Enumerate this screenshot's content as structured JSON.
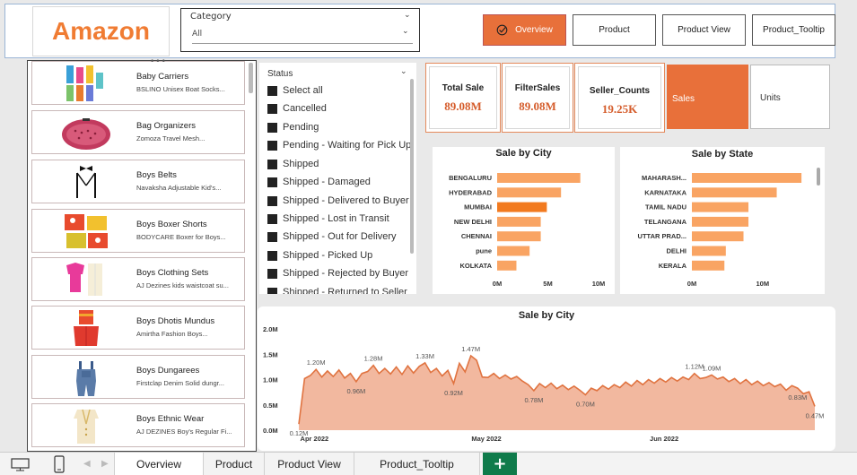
{
  "header": {
    "logo": "Amazon",
    "category_label": "Category",
    "category_value": "All",
    "nav": [
      "Overview",
      "Product",
      "Product View",
      "Product_Tooltip"
    ],
    "active_nav": "Overview"
  },
  "products": [
    {
      "name": "Baby Carriers",
      "desc": "BSLINO Unisex Boat Socks..."
    },
    {
      "name": "Bag Organizers",
      "desc": "Zomoza Travel Mesh..."
    },
    {
      "name": "Boys Belts",
      "desc": "Navaksha Adjustable Kid's..."
    },
    {
      "name": "Boys Boxer Shorts",
      "desc": "BODYCARE Boxer for Boys..."
    },
    {
      "name": "Boys Clothing Sets",
      "desc": "AJ Dezines kids waistcoat su..."
    },
    {
      "name": "Boys Dhotis Mundus",
      "desc": "Amirtha Fashion Boys..."
    },
    {
      "name": "Boys Dungarees",
      "desc": "Firstclap Denim Solid dungr..."
    },
    {
      "name": "Boys Ethnic Wear",
      "desc": "AJ DEZINES Boy's Regular Fi..."
    }
  ],
  "status": {
    "title": "Status",
    "items": [
      "Select all",
      "Cancelled",
      "Pending",
      "Pending - Waiting for Pick Up",
      "Shipped",
      "Shipped - Damaged",
      "Shipped - Delivered to Buyer",
      "Shipped - Lost in Transit",
      "Shipped - Out for Delivery",
      "Shipped - Picked Up",
      "Shipped - Rejected by Buyer",
      "Shipped - Returned to Seller"
    ]
  },
  "kpis": {
    "total_sale": {
      "label": "Total Sale",
      "value": "89.08M"
    },
    "filter_sales": {
      "label": "FilterSales",
      "value": "89.08M"
    },
    "seller_counts": {
      "label": "Seller_Counts",
      "value": "19.25K"
    }
  },
  "toggle": {
    "sales": "Sales",
    "units": "Units"
  },
  "colors": {
    "accent": "#e8703a",
    "bar": "#f9a463",
    "bar_highlight": "#f27a1f",
    "area_line": "#e07340",
    "area_fill": "#f2b89f"
  },
  "footer": {
    "tabs": [
      "Overview",
      "Product",
      "Product View",
      "Product_Tooltip"
    ],
    "active_tab": "Overview",
    "add_label": "+"
  },
  "chart_data": [
    {
      "type": "bar",
      "title": "Sale by City",
      "orientation": "horizontal",
      "categories": [
        "BENGALURU",
        "HYDERABAD",
        "MUMBAI",
        "NEW DELHI",
        "CHENNAI",
        "pune",
        "KOLKATA"
      ],
      "values": [
        8.2,
        6.3,
        4.9,
        4.3,
        4.3,
        3.2,
        1.9
      ],
      "highlight": "MUMBAI",
      "xticks": [
        "0M",
        "5M",
        "10M"
      ],
      "xlim": [
        0,
        10
      ]
    },
    {
      "type": "bar",
      "title": "Sale by State",
      "orientation": "horizontal",
      "categories": [
        "MAHARASH...",
        "KARNATAKA",
        "TAMIL NADU",
        "TELANGANA",
        "UTTAR PRAD...",
        "DELHI",
        "KERALA"
      ],
      "values": [
        15.5,
        12.0,
        8.0,
        8.0,
        7.3,
        4.8,
        4.6
      ],
      "xticks": [
        "0M",
        "10M"
      ],
      "xlim": [
        0,
        16.5
      ]
    },
    {
      "type": "area",
      "title": "Sale by City",
      "yticks": [
        "0.0M",
        "0.5M",
        "1.0M",
        "1.5M",
        "2.0M"
      ],
      "ylim": [
        0,
        2.0
      ],
      "xticks": [
        "Apr 2022",
        "May 2022",
        "Jun 2022"
      ],
      "x_range": [
        "2022-03-31",
        "2022-06-29"
      ],
      "labels": [
        {
          "date": "2022-03-31",
          "value": 0.12,
          "text": "0.12M"
        },
        {
          "date": "2022-04-03",
          "value": 1.2,
          "text": "1.20M"
        },
        {
          "date": "2022-04-10",
          "value": 0.96,
          "text": "0.96M"
        },
        {
          "date": "2022-04-13",
          "value": 1.28,
          "text": "1.28M"
        },
        {
          "date": "2022-04-22",
          "value": 1.33,
          "text": "1.33M"
        },
        {
          "date": "2022-04-27",
          "value": 0.92,
          "text": "0.92M"
        },
        {
          "date": "2022-04-30",
          "value": 1.47,
          "text": "1.47M"
        },
        {
          "date": "2022-05-11",
          "value": 0.78,
          "text": "0.78M"
        },
        {
          "date": "2022-05-20",
          "value": 0.7,
          "text": "0.70M"
        },
        {
          "date": "2022-06-08",
          "value": 1.12,
          "text": "1.12M"
        },
        {
          "date": "2022-06-11",
          "value": 1.09,
          "text": "1.09M"
        },
        {
          "date": "2022-06-26",
          "value": 0.83,
          "text": "0.83M"
        },
        {
          "date": "2022-06-29",
          "value": 0.47,
          "text": "0.47M"
        }
      ],
      "series": [
        {
          "values": [
            {
              "date": "2022-03-31",
              "value": 0.12
            },
            {
              "date": "2022-04-01",
              "value": 1.02
            },
            {
              "date": "2022-04-02",
              "value": 1.08
            },
            {
              "date": "2022-04-03",
              "value": 1.2
            },
            {
              "date": "2022-04-04",
              "value": 1.05
            },
            {
              "date": "2022-04-05",
              "value": 1.17
            },
            {
              "date": "2022-04-06",
              "value": 1.06
            },
            {
              "date": "2022-04-07",
              "value": 1.19
            },
            {
              "date": "2022-04-08",
              "value": 1.03
            },
            {
              "date": "2022-04-09",
              "value": 1.12
            },
            {
              "date": "2022-04-10",
              "value": 0.96
            },
            {
              "date": "2022-04-11",
              "value": 1.12
            },
            {
              "date": "2022-04-12",
              "value": 1.16
            },
            {
              "date": "2022-04-13",
              "value": 1.28
            },
            {
              "date": "2022-04-14",
              "value": 1.12
            },
            {
              "date": "2022-04-15",
              "value": 1.22
            },
            {
              "date": "2022-04-16",
              "value": 1.11
            },
            {
              "date": "2022-04-17",
              "value": 1.25
            },
            {
              "date": "2022-04-18",
              "value": 1.1
            },
            {
              "date": "2022-04-19",
              "value": 1.27
            },
            {
              "date": "2022-04-20",
              "value": 1.13
            },
            {
              "date": "2022-04-21",
              "value": 1.26
            },
            {
              "date": "2022-04-22",
              "value": 1.33
            },
            {
              "date": "2022-04-23",
              "value": 1.14
            },
            {
              "date": "2022-04-24",
              "value": 1.22
            },
            {
              "date": "2022-04-25",
              "value": 1.07
            },
            {
              "date": "2022-04-26",
              "value": 1.18
            },
            {
              "date": "2022-04-27",
              "value": 0.92
            },
            {
              "date": "2022-04-28",
              "value": 1.32
            },
            {
              "date": "2022-04-29",
              "value": 1.15
            },
            {
              "date": "2022-04-30",
              "value": 1.47
            },
            {
              "date": "2022-05-01",
              "value": 1.38
            },
            {
              "date": "2022-05-02",
              "value": 1.05
            },
            {
              "date": "2022-05-03",
              "value": 1.04
            },
            {
              "date": "2022-05-04",
              "value": 1.12
            },
            {
              "date": "2022-05-05",
              "value": 1.02
            },
            {
              "date": "2022-05-06",
              "value": 1.09
            },
            {
              "date": "2022-05-07",
              "value": 1.01
            },
            {
              "date": "2022-05-08",
              "value": 1.06
            },
            {
              "date": "2022-05-09",
              "value": 0.97
            },
            {
              "date": "2022-05-10",
              "value": 0.9
            },
            {
              "date": "2022-05-11",
              "value": 0.78
            },
            {
              "date": "2022-05-12",
              "value": 0.92
            },
            {
              "date": "2022-05-13",
              "value": 0.84
            },
            {
              "date": "2022-05-14",
              "value": 0.93
            },
            {
              "date": "2022-05-15",
              "value": 0.82
            },
            {
              "date": "2022-05-16",
              "value": 0.89
            },
            {
              "date": "2022-05-17",
              "value": 0.8
            },
            {
              "date": "2022-05-18",
              "value": 0.87
            },
            {
              "date": "2022-05-19",
              "value": 0.79
            },
            {
              "date": "2022-05-20",
              "value": 0.7
            },
            {
              "date": "2022-05-21",
              "value": 0.83
            },
            {
              "date": "2022-05-22",
              "value": 0.78
            },
            {
              "date": "2022-05-23",
              "value": 0.88
            },
            {
              "date": "2022-05-24",
              "value": 0.81
            },
            {
              "date": "2022-05-25",
              "value": 0.9
            },
            {
              "date": "2022-05-26",
              "value": 0.84
            },
            {
              "date": "2022-05-27",
              "value": 0.95
            },
            {
              "date": "2022-05-28",
              "value": 0.87
            },
            {
              "date": "2022-05-29",
              "value": 0.98
            },
            {
              "date": "2022-05-30",
              "value": 0.9
            },
            {
              "date": "2022-05-31",
              "value": 1.0
            },
            {
              "date": "2022-06-01",
              "value": 0.93
            },
            {
              "date": "2022-06-02",
              "value": 1.02
            },
            {
              "date": "2022-06-03",
              "value": 0.95
            },
            {
              "date": "2022-06-04",
              "value": 1.04
            },
            {
              "date": "2022-06-05",
              "value": 0.97
            },
            {
              "date": "2022-06-06",
              "value": 1.05
            },
            {
              "date": "2022-06-07",
              "value": 1.0
            },
            {
              "date": "2022-06-08",
              "value": 1.12
            },
            {
              "date": "2022-06-09",
              "value": 1.02
            },
            {
              "date": "2022-06-10",
              "value": 1.04
            },
            {
              "date": "2022-06-11",
              "value": 1.09
            },
            {
              "date": "2022-06-12",
              "value": 1.01
            },
            {
              "date": "2022-06-13",
              "value": 1.05
            },
            {
              "date": "2022-06-14",
              "value": 0.96
            },
            {
              "date": "2022-06-15",
              "value": 1.02
            },
            {
              "date": "2022-06-16",
              "value": 0.92
            },
            {
              "date": "2022-06-17",
              "value": 1.0
            },
            {
              "date": "2022-06-18",
              "value": 0.9
            },
            {
              "date": "2022-06-19",
              "value": 0.97
            },
            {
              "date": "2022-06-20",
              "value": 0.88
            },
            {
              "date": "2022-06-21",
              "value": 0.94
            },
            {
              "date": "2022-06-22",
              "value": 0.86
            },
            {
              "date": "2022-06-23",
              "value": 0.91
            },
            {
              "date": "2022-06-24",
              "value": 0.79
            },
            {
              "date": "2022-06-25",
              "value": 0.88
            },
            {
              "date": "2022-06-26",
              "value": 0.83
            },
            {
              "date": "2022-06-27",
              "value": 0.72
            },
            {
              "date": "2022-06-28",
              "value": 0.76
            },
            {
              "date": "2022-06-29",
              "value": 0.47
            }
          ]
        }
      ]
    }
  ]
}
